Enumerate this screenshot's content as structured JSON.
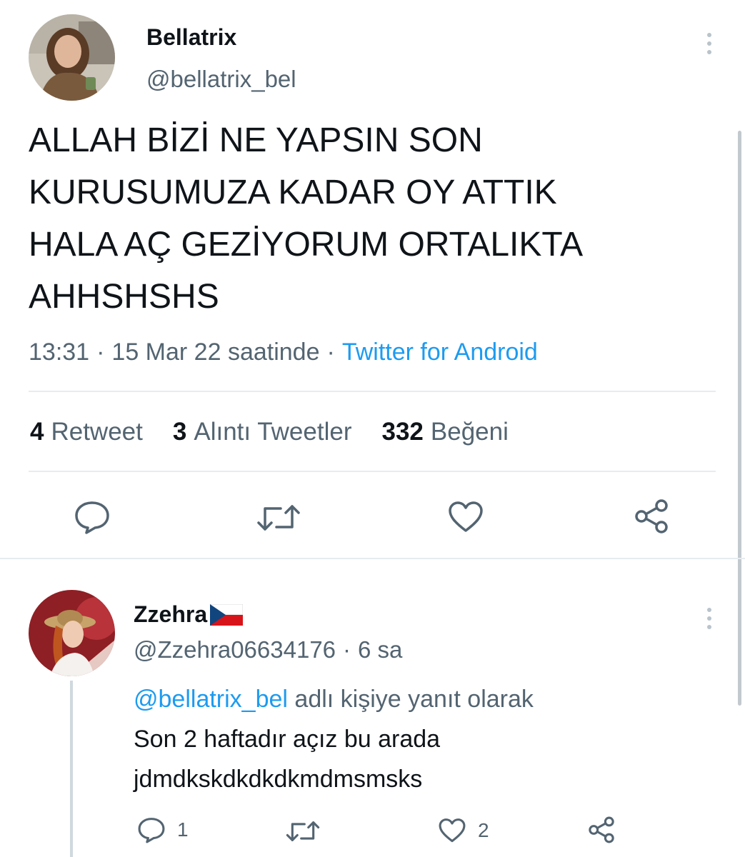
{
  "tweet": {
    "author": {
      "name": "Bellatrix",
      "handle": "@bellatrix_bel",
      "avatar_icon": "profile-photo-woman"
    },
    "text_lines": [
      "ALLAH BİZİ NE YAPSIN SON",
      "KURUSUMUZA KADAR OY ATTIK",
      "HALA AÇ GEZİYORUM ORTALIKTA",
      "AHHSHSHS"
    ],
    "time": "13:31",
    "sep1": "·",
    "date": "15 Mar 22 saatinde",
    "sep2": "·",
    "source": "Twitter for Android",
    "stats": {
      "retweets": {
        "count": "4",
        "label": "Retweet"
      },
      "quotes": {
        "count": "3",
        "label": "Alıntı Tweetler"
      },
      "likes": {
        "count": "332",
        "label": "Beğeni"
      }
    },
    "actions": [
      "reply-icon",
      "retweet-icon",
      "like-icon",
      "share-icon"
    ]
  },
  "reply": {
    "author": {
      "name": "Zzehra",
      "flag_icon": "czech-flag",
      "handle": "@Zzehra06634176",
      "sep": "·",
      "age": "6 sa",
      "avatar_icon": "profile-photo-girl-with-hat"
    },
    "replying_to": "@bellatrix_bel",
    "replying_suffix": "adlı kişiye yanıt olarak",
    "text_lines": [
      "Son 2 haftadır açız bu arada",
      "jdmdkskdkdkdkmdmsmsks"
    ],
    "counts": {
      "replies": "1",
      "retweets": "",
      "likes": "2"
    }
  },
  "colors": {
    "accent": "#1d9bf0",
    "secondary_text": "#536471",
    "divider": "#e6ecf0"
  }
}
